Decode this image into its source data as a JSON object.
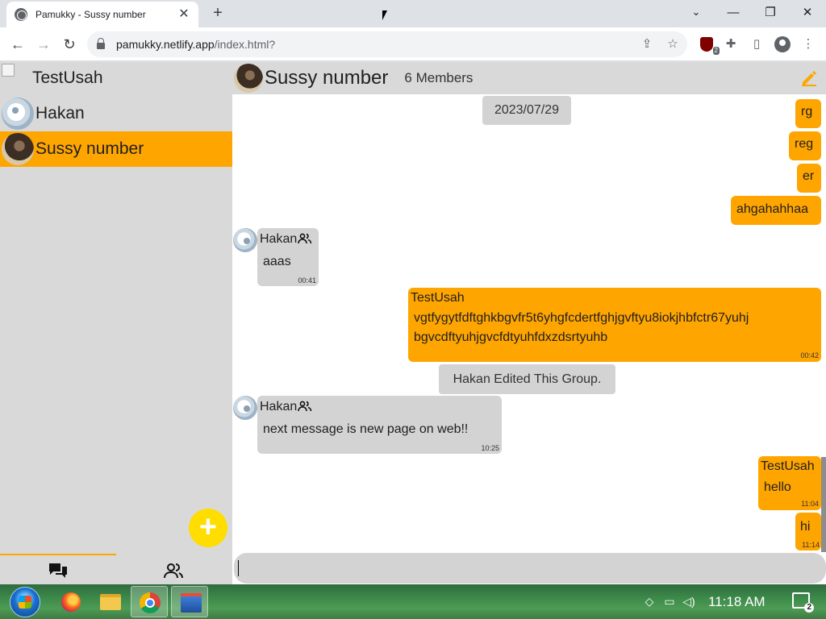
{
  "browser": {
    "tab_title": "Pamukky - Sussy number",
    "url_host": "pamukky.netlify.app",
    "url_path": "/index.html?"
  },
  "extensions": {
    "ublock_badge": "2"
  },
  "sidebar": {
    "current_user": "TestUsah",
    "chats": [
      {
        "name": "Hakan",
        "active": false
      },
      {
        "name": "Sussy number",
        "active": true
      }
    ],
    "add_button": "+"
  },
  "chat": {
    "title": "Sussy number",
    "members": "6 Members",
    "date": "2023/07/29",
    "messages": [
      {
        "dir": "out",
        "text": "rg"
      },
      {
        "dir": "out",
        "text": "reg"
      },
      {
        "dir": "out",
        "text": "er"
      },
      {
        "dir": "out",
        "text": "ahgahahhaa"
      },
      {
        "dir": "in",
        "sender": "Hakan",
        "text": "aaas",
        "time": "00:41"
      },
      {
        "dir": "out",
        "sender": "TestUsah",
        "text": "vgtfygytfdftghkbgvfr5t6yhgfcdertfghjgvftyu8iokjhbfctr67yuhjbgvcdftyuhjgvcfdtyuhfdxzdsrtyuhb",
        "line1": "vgtfygytfdftghkbgvfr5t6yhgfcdertfghjgvftyu8iokjhbfctr67yuhj",
        "line2": "bgvcdftyuhjgvcfdtyuhfdxzdsrtyuhb",
        "time": "00:42"
      },
      {
        "dir": "system",
        "text": "Hakan Edited This Group."
      },
      {
        "dir": "in",
        "sender": "Hakan",
        "text": "next message is new page on web!!",
        "time": "10:25"
      },
      {
        "dir": "out",
        "sender": "TestUsah",
        "text": "hello",
        "time": "11:04"
      },
      {
        "dir": "out",
        "text": "hi",
        "time": "11:14"
      }
    ]
  },
  "taskbar": {
    "clock": "11:18 AM",
    "notification_count": "2"
  },
  "colors": {
    "accent": "#ffa500",
    "fab": "#ffdd00",
    "panel": "#d9d9d9",
    "bubble_in": "#d3d3d3"
  },
  "icons": {
    "chats_tab": "chat-bubbles-icon",
    "contacts_tab": "people-icon",
    "edit": "pencil-icon",
    "group": "people-icon"
  }
}
